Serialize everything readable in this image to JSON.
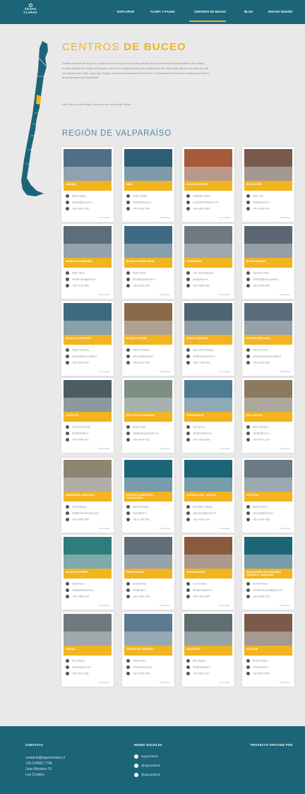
{
  "brand": {
    "logo_line1": "AGUAS",
    "logo_line2": "CLARAS"
  },
  "nav": {
    "items": [
      "EXPLORAR",
      "FLORA Y FAUNA",
      "CENTROS DE BUCEO",
      "BLOG",
      "INICIAR SESIÓN"
    ],
    "active": "CENTROS DE BUCEO"
  },
  "hero": {
    "title_light": "CENTROS",
    "title_bold": "DE BUCEO",
    "intro": "Existen centros de buceo a lo largo de todo el país, los cuales podrán ser la entrada al descubrimiento de nuestro mundo submarino. Antes de buscar, conoce el equipamiento y las condiciones de buceo que ofrecen en cada una de las regiones de Chile, para que tengas una buena experiencia de buceo. Te invitamos a buscar los centros que tienen la información que necesitas.",
    "instruction": "Haz click en cada región para ver los centros de buceo."
  },
  "region_title": "REGIÓN DE VALPARAÍSO",
  "card_more": "Ver detalles",
  "centers": [
    {
      "name": "ABISMO",
      "contact": "Daniel Inghay",
      "email": "abismo@gmail.com",
      "phone": "+56 9 8929 2970"
    },
    {
      "name": "ABIS",
      "contact": "Diego Canales",
      "email": "info@abisbuceo.cl",
      "phone": "+56 32 263 7990"
    },
    {
      "name": "ACUATIC DIVERS",
      "contact": "Sebastián Aguirre",
      "email": "acuaticdivers@gmail.com",
      "phone": "+56 9 8812 3990"
    },
    {
      "name": "BUCEO SUR",
      "contact": "Darío Vera",
      "email": "info@buceosur.cl",
      "phone": "+56 9 5226 4291"
    },
    {
      "name": "BUCEO ALGARROBO",
      "contact": "Pablo Jacob",
      "email": "info@buceoalgarrobo.cl",
      "phone": "+56 9 9105 4900"
    },
    {
      "name": "BUCEO CASABLANCA",
      "contact": "David Toledo",
      "email": "buceo@casablanca.cl",
      "phone": "+56 9 6125 3422"
    },
    {
      "name": "CORMORAN",
      "contact": "Juan José Rodríguez",
      "email": "jjro@gmail.com",
      "phone": "+56 9 8984 1990"
    },
    {
      "name": "BUCEO QUINAY",
      "contact": "Laureano Orrico",
      "email": "contacto@buceoquinay.cl",
      "phone": "+56 9 5392 5360"
    },
    {
      "name": "BUCEO VALPARAÍSO",
      "contact": "Diego Fernández",
      "email": "contacto@buceovalpo.cl",
      "phone": "+56 9 9448 4012"
    },
    {
      "name": "BUCEO LITORAL",
      "contact": "Pablo Fernández",
      "email": "pfbuceo@gmail.com",
      "phone": "+56 9 6431 1754"
    },
    {
      "name": "CINCO OCÉANOS",
      "contact": "Juan José Rodríguez",
      "email": "info@cincooceanos.cl",
      "phone": "+56 9 7088 4223"
    },
    {
      "name": "DIVERS VENTANAS",
      "contact": "Alex de Ferrari",
      "email": "contacto@diversventanas.cl",
      "phone": "+56 9 6226 1463"
    },
    {
      "name": "DIVERLIFE",
      "contact": "Francisco Astorga",
      "email": "info@diverlife.cl",
      "phone": "+56 9 6543 4021"
    },
    {
      "name": "EXPLORA SUBMARINO",
      "contact": "Daniel Rojas",
      "email": "info@explorasubmarino.cl",
      "phone": "+56 9 9514 4321"
    },
    {
      "name": "FORMANDIVE",
      "contact": "Juan Quiroz",
      "email": "info@formandive.cl",
      "phone": "+56 9 6226 2433"
    },
    {
      "name": "FULL BUCEO",
      "contact": "Mario Pellegrini",
      "email": "info@fullbuceo.cl",
      "phone": "+56 9 9711 1210"
    },
    {
      "name": "INMERSIÓN AVENTURA",
      "contact": "Gerald Bracey",
      "email": "info@inmersionaventura.cl",
      "phone": "+56 9 8608 7990"
    },
    {
      "name": "INSTITUTO MARITIMO VALPARAÍSO",
      "contact": "Marcos Morales",
      "email": "buceo@imv.cl",
      "phone": "+56 32 249 3041"
    },
    {
      "name": "LAGUNA AZUL - BUCEO",
      "contact": "Maximiliano Zapata",
      "email": "lagunaazul@gmail.com",
      "phone": "+56 9 4330 1410"
    },
    {
      "name": "OCTOPUS",
      "contact": "Ricardo Muñoz",
      "email": "octopus@gmail.com",
      "phone": "+56 9 9933 4326"
    },
    {
      "name": "PACÍFICO DIVERS",
      "contact": "Daniel Soto",
      "email": "info@pacificodivers.cl",
      "phone": "+56 9 7586 2015"
    },
    {
      "name": "PIRITA BUCEO",
      "contact": "Esteban Soto",
      "email": "info@pirita.cl",
      "phone": "+56 9 9622 1990"
    },
    {
      "name": "PUNTA DIVERS",
      "contact": "Luis González",
      "email": "info@puntadivers.cl",
      "phone": "+56 9 7813 1049"
    },
    {
      "name": "ASOCIACIÓN PESCADORES CALETA EL MANZANO",
      "contact": "Antonio Tirado",
      "email": "caletaelmanzano@gmail.com",
      "phone": "+56 9 5638 1213"
    },
    {
      "name": "SUBVAL",
      "contact": "Rubí Zapata",
      "email": "subval@gmail.com",
      "phone": "+56 9 8124 4811"
    },
    {
      "name": "TENCTE DE TURISMO",
      "contact": "Pablo Muñoz",
      "email": "contacto@tencte.cl",
      "phone": "+56 9 6432 1403"
    },
    {
      "name": "VALPADIVE",
      "contact": "Nino Zapata",
      "email": "info@valpadive.cl",
      "phone": "+56 9 6430 1102"
    },
    {
      "name": "VITA SUB",
      "contact": "Ricardo Castro",
      "email": "info@vitasub.cl",
      "phone": "+56 9 8227 5514"
    }
  ],
  "footer": {
    "contact_title": "CONTACTO",
    "contact_lines": [
      "contacto@aguasclaras.cl",
      "+56 9 8902 7706",
      "Juan Montero 51",
      "Las Condes"
    ],
    "social_title": "REDES SOCIALES",
    "social": [
      "/aguasclaras",
      "@aguasclaras",
      "@aguasclaras"
    ],
    "support_title": "PROYECTO APOYADO POR"
  }
}
